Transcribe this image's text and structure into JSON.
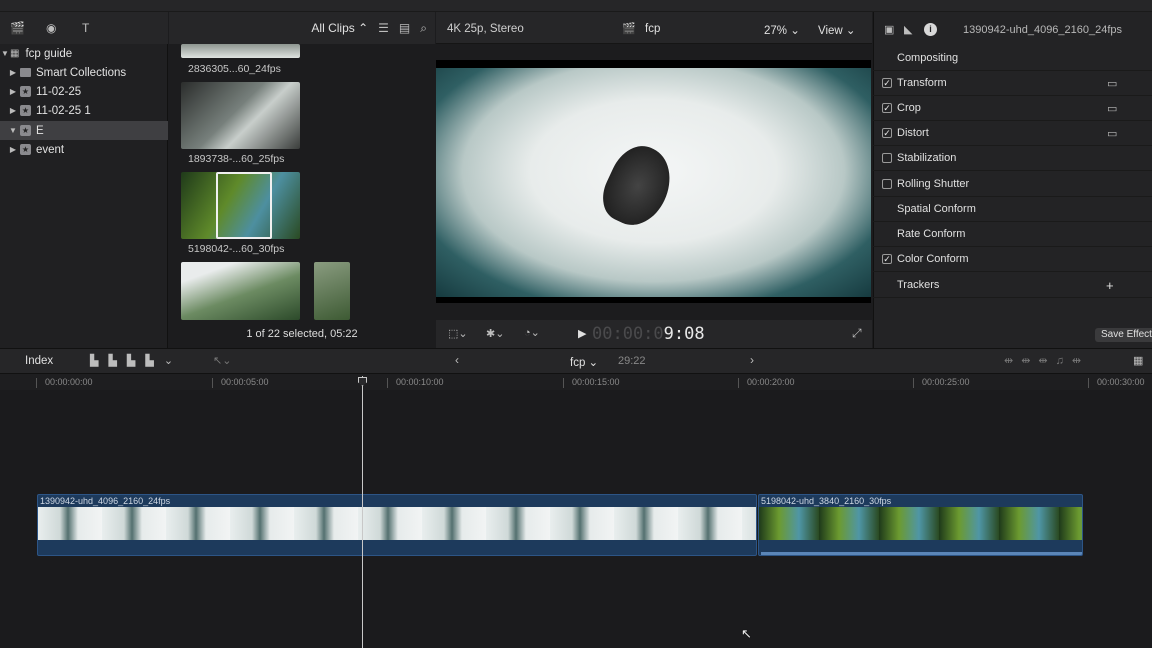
{
  "library": {
    "root": "fcp guide",
    "items": [
      {
        "label": "Smart Collections"
      },
      {
        "label": "11-02-25"
      },
      {
        "label": "11-02-25 1"
      },
      {
        "label": "E"
      },
      {
        "label": "event"
      }
    ]
  },
  "browser": {
    "filter": "All Clips",
    "clips": [
      {
        "name": "2836305...60_24fps"
      },
      {
        "name": "1893738-...60_25fps"
      },
      {
        "name": "5198042-...60_30fps"
      }
    ],
    "footer": "1 of 22 selected, 05:22"
  },
  "viewer": {
    "format": "4K 25p, Stereo",
    "project": "fcp",
    "zoom": "27%",
    "view_label": "View",
    "timecode_dim": "00:00:0",
    "timecode": "9:08"
  },
  "inspector": {
    "clip_title": "1390942-uhd_4096_2160_24fps",
    "save_effects": "Save Effects",
    "rows": [
      {
        "label": "Compositing",
        "check": ""
      },
      {
        "label": "Transform",
        "check": "✓"
      },
      {
        "label": "Crop",
        "check": "✓"
      },
      {
        "label": "Distort",
        "check": "✓"
      },
      {
        "label": "Stabilization",
        "check": ""
      },
      {
        "label": "Rolling Shutter",
        "check": ""
      },
      {
        "label": "Spatial Conform",
        "check": ""
      },
      {
        "label": "Rate Conform",
        "check": ""
      },
      {
        "label": "Color Conform",
        "check": "✓"
      },
      {
        "label": "Trackers",
        "check": ""
      }
    ]
  },
  "timeline": {
    "index_label": "Index",
    "project": "fcp",
    "duration": "29:22",
    "ticks": [
      "00:00:00:00",
      "00:00:05:00",
      "00:00:10:00",
      "00:00:15:00",
      "00:00:20:00",
      "00:00:25:00",
      "00:00:30:00"
    ],
    "clips": [
      {
        "name": "1390942-uhd_4096_2160_24fps"
      },
      {
        "name": "5198042-uhd_3840_2160_30fps"
      }
    ]
  },
  "colors": {
    "accent": "#2d5586",
    "clip": "#1d3a5c"
  },
  "icons": [
    "play-icon",
    "search-icon",
    "gear-icon",
    "info-icon",
    "fullscreen-icon",
    "cursor-icon"
  ]
}
